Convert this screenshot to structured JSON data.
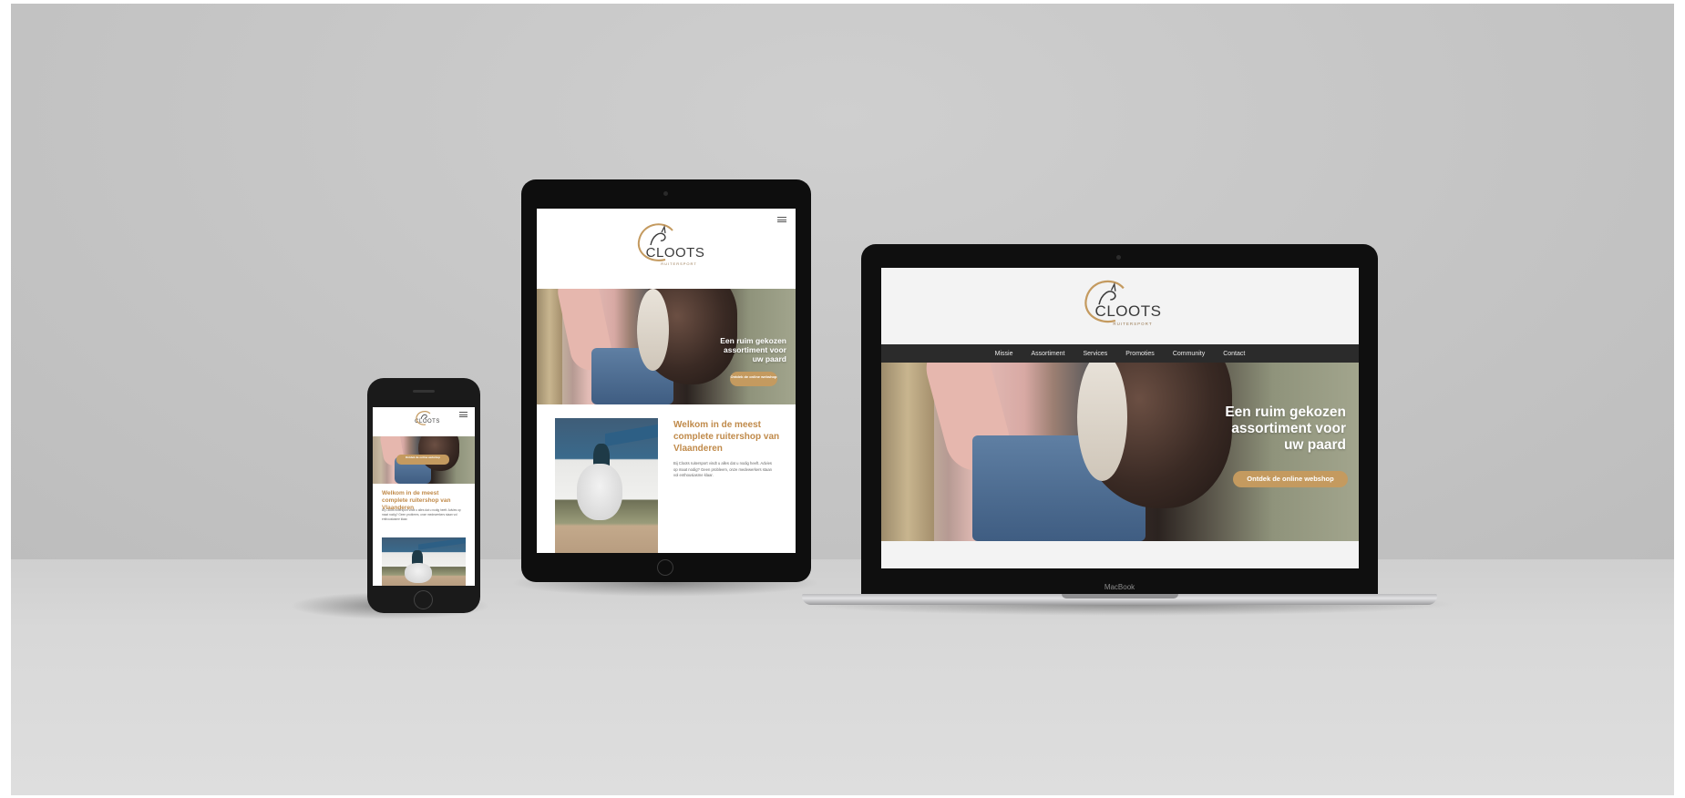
{
  "brand": {
    "name": "CLOOTS",
    "subtitle": "RUITERSPORT",
    "accent": "#c49a5f"
  },
  "nav": {
    "items": [
      "Missie",
      "Assortiment",
      "Services",
      "Promoties",
      "Community",
      "Contact"
    ]
  },
  "hero": {
    "title_lines": [
      "Een ruim gekozen",
      "assortiment voor",
      "uw paard"
    ],
    "button": "Ontdek de online webshop",
    "button_tablet": "Ontdek de online webshop"
  },
  "welcome": {
    "title": "Welkom in de meest complete ruitershop van Vlaanderen",
    "text": "Bij Cloots ruitersport vindt u alles dat u nodig heeft. Advies op maat nodig? Geen probleem, onze medewerkers staan vol enthousiasme klaar."
  },
  "laptop": {
    "label": "MacBook"
  },
  "colors": {
    "title": "#c08a4a",
    "nav_bg": "#2b2b2b",
    "button": "#c49a5f"
  }
}
